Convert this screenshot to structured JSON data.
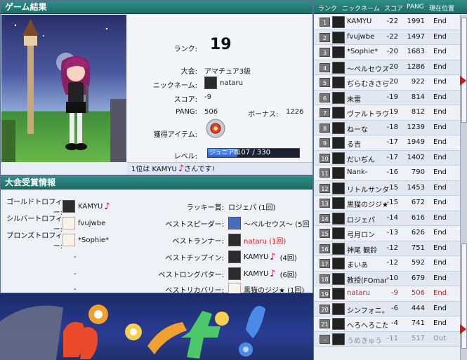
{
  "result_panel": {
    "title": "ゲーム結果",
    "rank_label": "ランク:",
    "rank_value": "19",
    "tournament_label": "大会:",
    "tournament_value": "アマチュア3級",
    "nickname_label": "ニックネーム:",
    "nickname_value": "nataru",
    "score_label": "スコア:",
    "score_value": "-9",
    "pang_label": "PANG:",
    "pang_value": "506",
    "bonus_label": "ボーナス:",
    "bonus_value": "1226",
    "item_label": "獲得アイテム:",
    "level_label": "レベル:",
    "level_prefix": "ジュニアB",
    "level_text": "107 / 330",
    "level_progress": 0.324,
    "winner_text": "1位は KAMYU",
    "winner_suffix": "さんです!"
  },
  "awards_panel": {
    "title": "大会受賞情報",
    "gold_label": "ゴールドトロフィー:",
    "gold_value": "KAMYU",
    "silver_label": "シルバートロフィー:",
    "silver_value": "fvujwbe",
    "bronze_label": "ブロンズトロフィー:",
    "bronze_value": "*Sophie*",
    "dash": "-",
    "lucky_label": "ラッキー賞:",
    "lucky_value": "ロジェパ (1回)",
    "speeder_label": "ベストスピーダー:",
    "speeder_value": "～ペルセウス～ (5回",
    "runner_label": "ベストランナー:",
    "runner_value": "nataru (1回)",
    "chipin_label": "ベストチップイン:",
    "chipin_value": "KAMYU",
    "chipin_count": "(4回)",
    "longputter_label": "ベストロングパター:",
    "longputter_value": "KAMYU",
    "longputter_count": "(6回)",
    "recovery_label": "ベストリカバリー:",
    "recovery_value": "黒猫のジジ★ (1回)"
  },
  "ranking": {
    "headers": {
      "rank": "ランク",
      "nick": "ニックネーム",
      "score": "スコア",
      "pang": "PANG",
      "pos": "現在位置"
    },
    "rows": [
      {
        "rank": "1",
        "name": "KAMYU",
        "score": "-22",
        "pang": "1991",
        "pos": "End"
      },
      {
        "rank": "2",
        "name": "fvujwbe",
        "score": "-22",
        "pang": "1497",
        "pos": "End"
      },
      {
        "rank": "3",
        "name": "*Sophie*",
        "score": "-20",
        "pang": "1683",
        "pos": "End"
      },
      {
        "rank": "4",
        "name": "～ペルセウス～",
        "score": "-20",
        "pang": "1286",
        "pos": "End"
      },
      {
        "rank": "5",
        "name": "ぢらむきさら",
        "score": "-20",
        "pang": "922",
        "pos": "End"
      },
      {
        "rank": "6",
        "name": "未雷",
        "score": "-19",
        "pang": "814",
        "pos": "End"
      },
      {
        "rank": "7",
        "name": "ヴァルトラウテ",
        "score": "-19",
        "pang": "812",
        "pos": "End"
      },
      {
        "rank": "8",
        "name": "ねーな",
        "score": "-18",
        "pang": "1239",
        "pos": "End"
      },
      {
        "rank": "9",
        "name": "る吉",
        "score": "-17",
        "pang": "1949",
        "pos": "End"
      },
      {
        "rank": "10",
        "name": "だいぢん",
        "score": "-17",
        "pang": "1402",
        "pos": "End"
      },
      {
        "rank": "11",
        "name": "Nank-",
        "score": "-16",
        "pang": "790",
        "pos": "End"
      },
      {
        "rank": "12",
        "name": "リトルサンタ",
        "score": "-15",
        "pang": "1453",
        "pos": "End"
      },
      {
        "rank": "13",
        "name": "黒猫のジジ★",
        "score": "-15",
        "pang": "672",
        "pos": "End"
      },
      {
        "rank": "14",
        "name": "ロジェパ",
        "score": "-14",
        "pang": "616",
        "pos": "End"
      },
      {
        "rank": "15",
        "name": "弓月ロン",
        "score": "-13",
        "pang": "626",
        "pos": "End"
      },
      {
        "rank": "16",
        "name": "神尾 観鈴",
        "score": "-12",
        "pang": "751",
        "pos": "End"
      },
      {
        "rank": "17",
        "name": "まいあ",
        "score": "-12",
        "pang": "592",
        "pos": "End"
      },
      {
        "rank": "18",
        "name": "教授(FOmar)",
        "score": "-10",
        "pang": "679",
        "pos": "End"
      },
      {
        "rank": "19",
        "name": "nataru",
        "score": "-9",
        "pang": "506",
        "pos": "End"
      },
      {
        "rank": "20",
        "name": "シンフォニ。",
        "score": "-6",
        "pang": "444",
        "pos": "End"
      },
      {
        "rank": "21",
        "name": "へろへろこたろ",
        "score": "-4",
        "pang": "741",
        "pos": "End"
      },
      {
        "rank": "-",
        "name": "うめきゅう",
        "score": "-11",
        "pang": "517",
        "pos": "Out"
      }
    ]
  },
  "colors": {
    "header_teal": "#1d6d66",
    "accent_red": "#d02020",
    "level_blue": "#2a5fd8"
  }
}
